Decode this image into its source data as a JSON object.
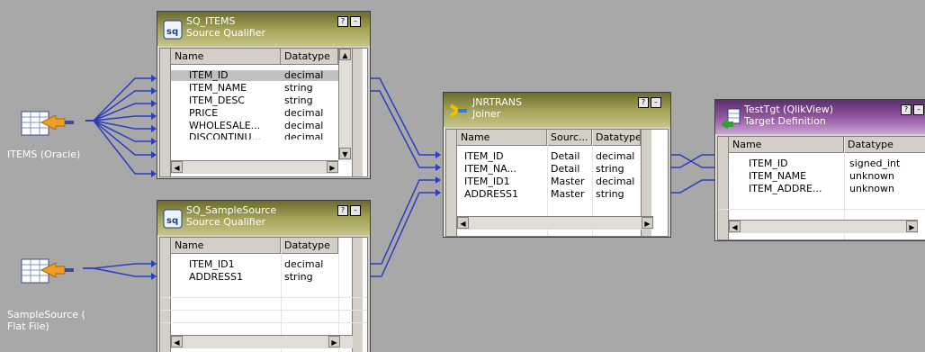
{
  "sources": [
    {
      "label_line1": "ITEMS (Oracle)",
      "label_line2": ""
    },
    {
      "label_line1": "SampleSource (",
      "label_line2": "Flat File)"
    }
  ],
  "sq_items": {
    "name": "SQ_ITEMS",
    "type": "Source Qualifier",
    "col_name": "Name",
    "col_datatype": "Datatype",
    "rows": [
      {
        "name": "ITEM_ID",
        "datatype": "decimal"
      },
      {
        "name": "ITEM_NAME",
        "datatype": "string"
      },
      {
        "name": "ITEM_DESC",
        "datatype": "string"
      },
      {
        "name": "PRICE",
        "datatype": "decimal"
      },
      {
        "name": "WHOLESALE...",
        "datatype": "decimal"
      },
      {
        "name": "DISCONTINU...",
        "datatype": "decimal"
      }
    ]
  },
  "sq_sample": {
    "name": "SQ_SampleSource",
    "type": "Source Qualifier",
    "col_name": "Name",
    "col_datatype": "Datatype",
    "rows": [
      {
        "name": "ITEM_ID1",
        "datatype": "decimal"
      },
      {
        "name": "ADDRESS1",
        "datatype": "string"
      }
    ]
  },
  "joiner": {
    "name": "JNRTRANS",
    "type": "Joiner",
    "col_name": "Name",
    "col_source": "Sourc...",
    "col_datatype": "Datatype",
    "rows": [
      {
        "name": "ITEM_ID",
        "source": "Detail",
        "datatype": "decimal"
      },
      {
        "name": "ITEM_NA...",
        "source": "Detail",
        "datatype": "string"
      },
      {
        "name": "ITEM_ID1",
        "source": "Master",
        "datatype": "decimal"
      },
      {
        "name": "ADDRESS1",
        "source": "Master",
        "datatype": "string"
      }
    ]
  },
  "target": {
    "name": "TestTgt (QlikView)",
    "type": "Target Definition",
    "col_name": "Name",
    "col_datatype": "Datatype",
    "rows": [
      {
        "name": "ITEM_ID",
        "datatype": "signed_int"
      },
      {
        "name": "ITEM_NAME",
        "datatype": "unknown"
      },
      {
        "name": "ITEM_ADDRE...",
        "datatype": "unknown"
      }
    ]
  },
  "buttons": {
    "help": "?",
    "minimize": "–"
  },
  "colors": {
    "canvas": "#a8a8a8",
    "link": "#2a3ec0",
    "olive_header": "#a7a659",
    "purple_header": "#9a5aa8"
  }
}
